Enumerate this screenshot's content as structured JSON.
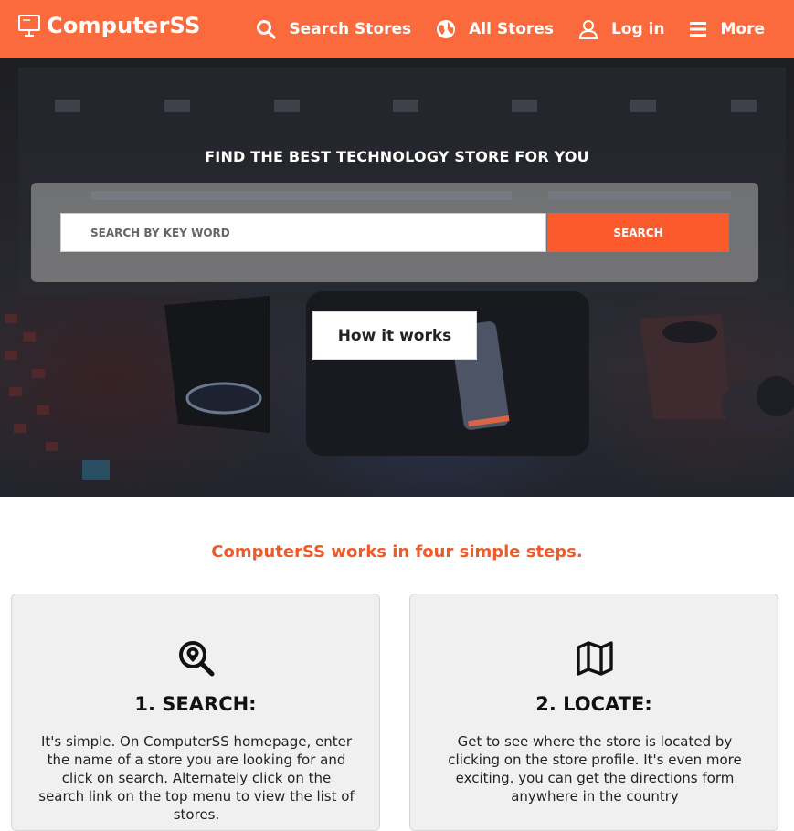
{
  "header": {
    "brand": "ComputerSS",
    "nav": [
      {
        "icon": "search-icon",
        "label": "Search Stores"
      },
      {
        "icon": "globe-icon",
        "label": "All Stores"
      },
      {
        "icon": "user-icon",
        "label": "Log in"
      },
      {
        "icon": "menu-icon",
        "label": "More"
      }
    ]
  },
  "hero": {
    "title": "FIND THE BEST TECHNOLOGY STORE FOR YOU",
    "search_placeholder": "SEARCH BY KEY WORD",
    "search_label": "SEARCH",
    "how_label": "How it works"
  },
  "steps": {
    "heading": "ComputerSS works in four simple steps.",
    "cards": [
      {
        "icon": "search-location-icon",
        "title": "1. SEARCH:",
        "text": "It's simple. On ComputerSS homepage, enter the name of a store you are looking for and click on search. Alternately click on the search link on the top menu to view the list of stores."
      },
      {
        "icon": "map-icon",
        "title": "2. LOCATE:",
        "text": "Get to see where the store is located by clicking on the store profile. It's even more exciting. you can get the directions form anywhere in the country"
      }
    ]
  },
  "colors": {
    "brand": "#fb6a3c",
    "accent": "#fb5a2c",
    "heading": "#f05a28"
  }
}
